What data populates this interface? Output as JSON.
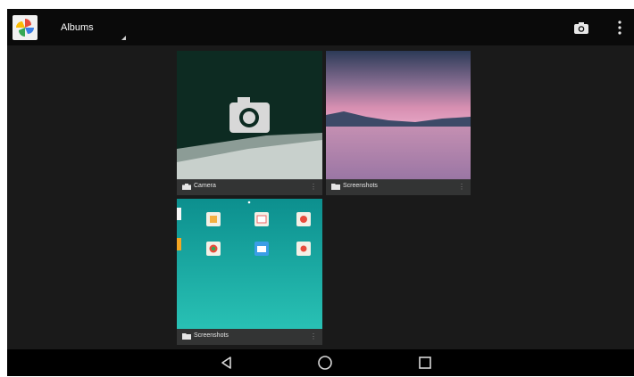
{
  "actionbar": {
    "title": "Albums",
    "app_icon": "photos-pinwheel-icon",
    "camera_icon": "camera-icon",
    "overflow_icon": "more-vert-icon"
  },
  "albums": [
    {
      "name": "Camera",
      "icon": "camera-icon"
    },
    {
      "name": "Screenshots",
      "icon": "folder-icon"
    },
    {
      "name": "Screenshots",
      "icon": "folder-icon"
    }
  ],
  "navbar": {
    "back_icon": "back-triangle-icon",
    "home_icon": "home-circle-icon",
    "recents_icon": "recents-square-icon"
  },
  "colors": {
    "actionbar": "#0a0a0a",
    "background": "#1a1a1a",
    "navbar": "#000000",
    "screenshot_teal": "#16b3ad"
  }
}
